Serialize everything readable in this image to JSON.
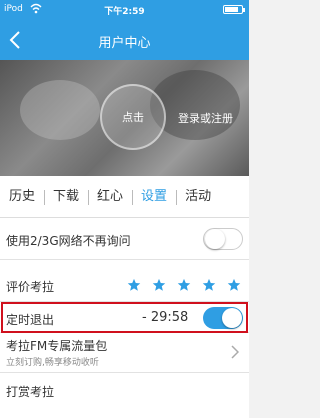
{
  "status_bar": {
    "carrier": "iPod",
    "time": "下午2:59",
    "wifi_icon": "wifi-icon",
    "battery_icon": "battery-icon",
    "battery_level": 0.8
  },
  "nav": {
    "title": "用户中心",
    "back_icon": "chevron-left-icon"
  },
  "hero": {
    "avatar_text": "点击",
    "login_text": "登录或注册"
  },
  "tabs": [
    {
      "label": "历史"
    },
    {
      "label": "下载"
    },
    {
      "label": "红心"
    },
    {
      "label": "设置",
      "active": true
    },
    {
      "label": "活动"
    }
  ],
  "settings": {
    "network_label": "使用2/3G网络不再询问",
    "network_enabled": false,
    "rate_label": "评价考拉",
    "rate_stars": 5,
    "timer_label": "定时退出",
    "timer_value": "- 29:58",
    "timer_enabled": true,
    "fm_label": "考拉FM专属流量包",
    "fm_sub": "立刻订购,畅享移动收听",
    "reward_label": "打赏考拉"
  },
  "colors": {
    "accent": "#2f9ee3",
    "highlight": "#d0101d"
  }
}
